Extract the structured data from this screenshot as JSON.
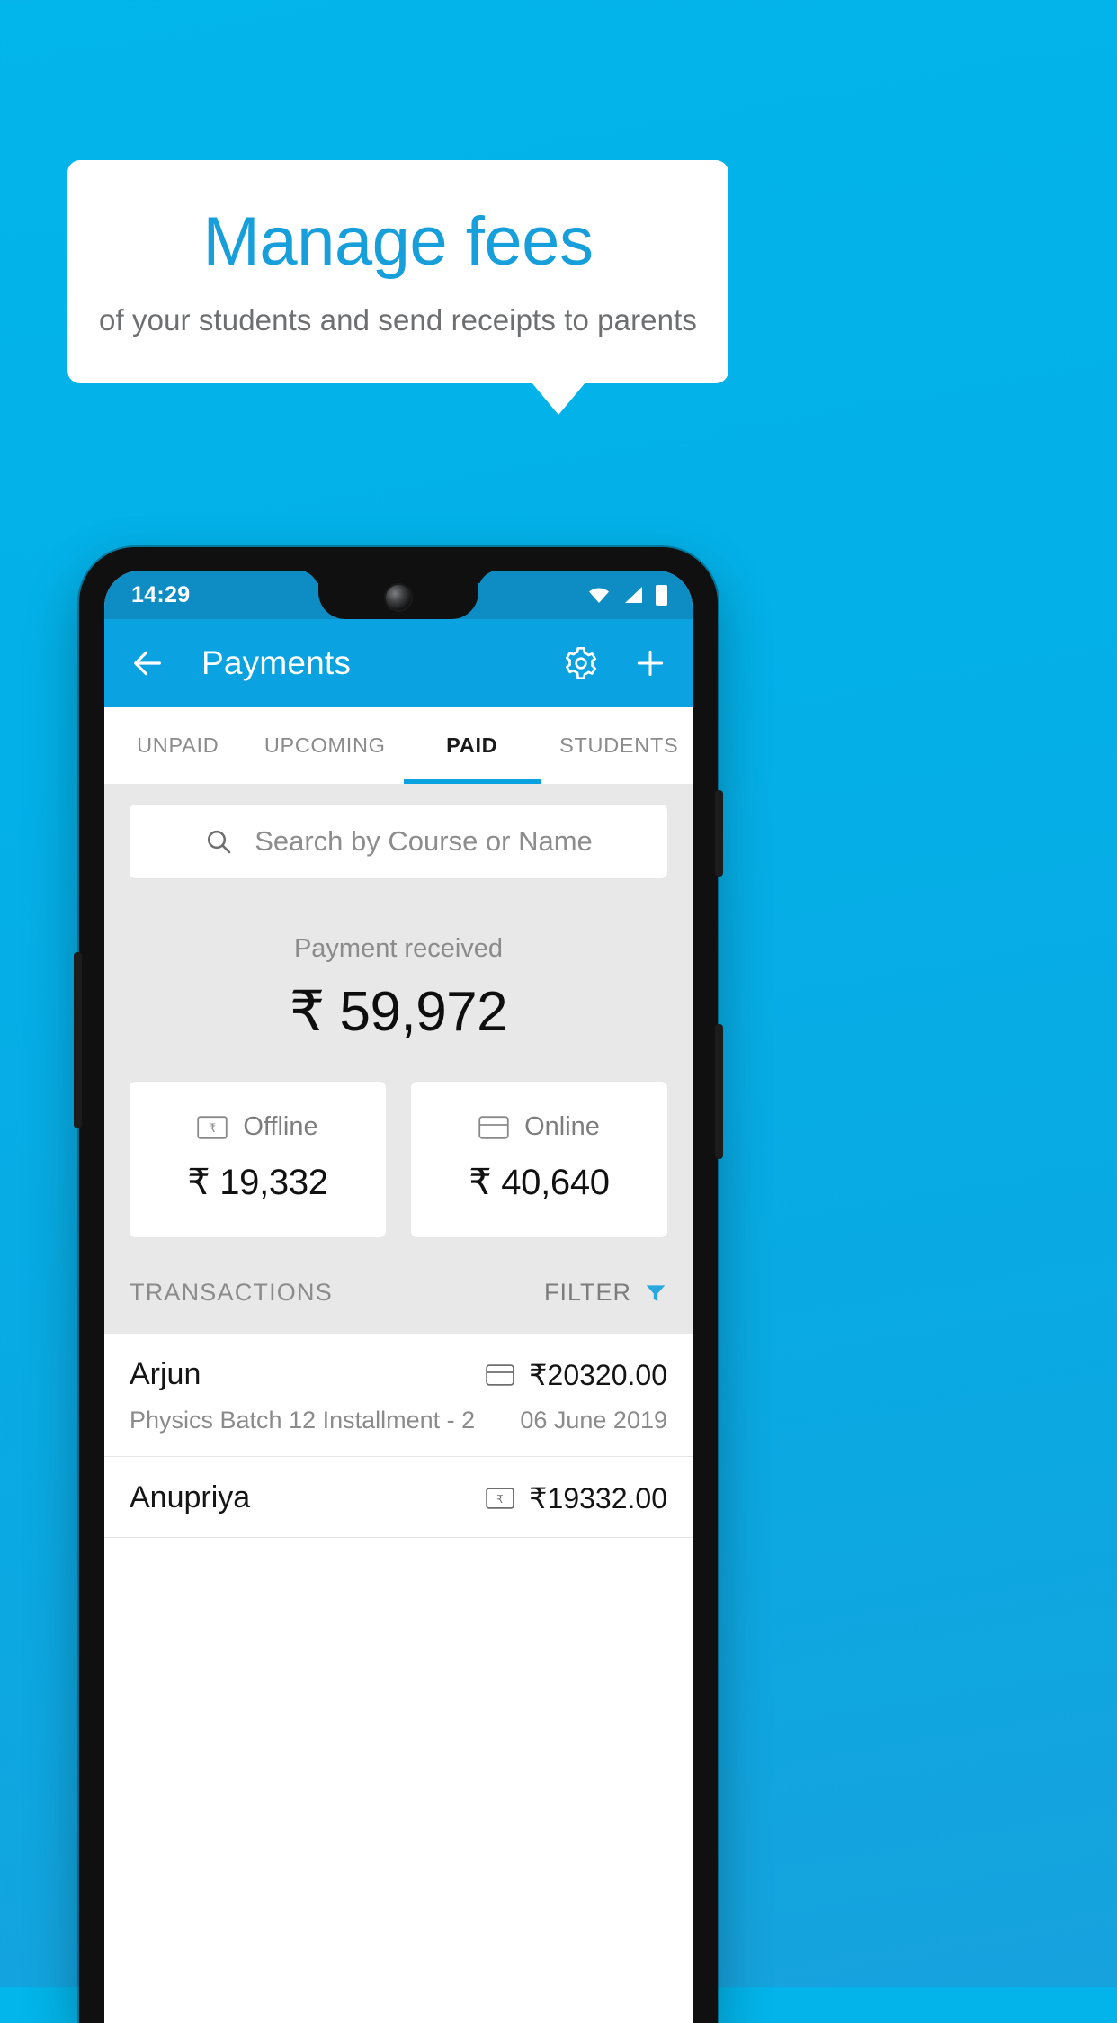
{
  "promo": {
    "title": "Manage fees",
    "subtitle": "of your students and send receipts to parents",
    "background_color": "#03b0e8",
    "title_color": "#169fdb",
    "card_color": "#ffffff"
  },
  "phone": {
    "status_bar": {
      "time": "14:29",
      "icons": [
        "wifi-icon",
        "signal-icon",
        "battery-icon"
      ],
      "background_color": "#0e8cc4"
    },
    "app_bar": {
      "back_icon": "back-arrow-icon",
      "title": "Payments",
      "settings_icon": "gear-icon",
      "add_icon": "plus-icon",
      "background_color": "#0aa2e0"
    },
    "tabs": [
      {
        "label": "UNPAID",
        "active": false
      },
      {
        "label": "UPCOMING",
        "active": false
      },
      {
        "label": "PAID",
        "active": true
      },
      {
        "label": "STUDENTS",
        "active": false
      }
    ],
    "search": {
      "icon": "search-icon",
      "placeholder": "Search by Course or Name",
      "value": ""
    },
    "summary": {
      "label": "Payment received",
      "amount": "₹ 59,972"
    },
    "payment_cards": [
      {
        "icon": "rupee-note-icon",
        "label": "Offline",
        "amount": "₹ 19,332"
      },
      {
        "icon": "credit-card-icon",
        "label": "Online",
        "amount": "₹ 40,640"
      }
    ],
    "transactions_header": {
      "title": "TRANSACTIONS",
      "filter_label": "FILTER",
      "filter_icon": "funnel-icon",
      "filter_icon_color": "#29a8e0"
    },
    "transactions": [
      {
        "name": "Arjun",
        "description": "Physics Batch 12 Installment - 2",
        "mode_icon": "credit-card-icon",
        "amount": "₹20320.00",
        "date": "06 June 2019"
      },
      {
        "name": "Anupriya",
        "description": "",
        "mode_icon": "rupee-note-icon",
        "amount": "₹19332.00",
        "date": ""
      }
    ]
  }
}
